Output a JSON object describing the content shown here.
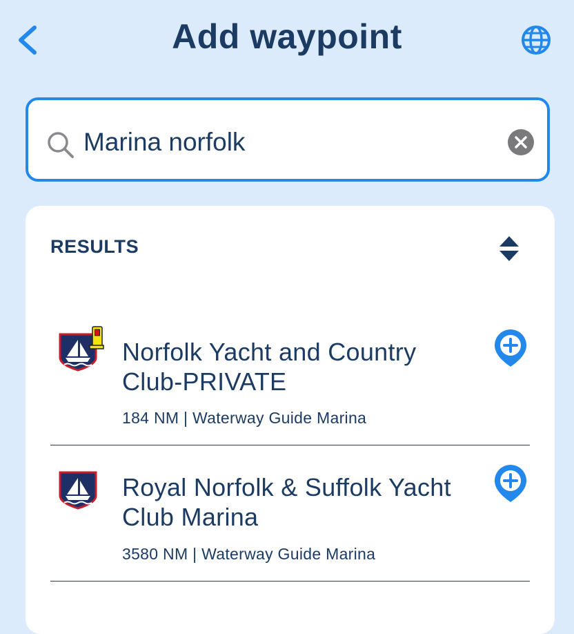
{
  "header": {
    "title": "Add waypoint"
  },
  "search": {
    "value": "Marina norfolk",
    "placeholder": ""
  },
  "results": {
    "heading": "RESULTS",
    "items": [
      {
        "title": "Norfolk Yacht and Country Club-PRIVATE",
        "meta": "184 NM | Waterway Guide Marina",
        "has_fuel_badge": true
      },
      {
        "title": "Royal Norfolk & Suffolk Yacht Club Marina",
        "meta": "3580 NM | Waterway Guide Marina",
        "has_fuel_badge": false
      }
    ]
  },
  "colors": {
    "accent": "#2388ec",
    "text": "#1c3b63",
    "background": "#dcebfb",
    "marina_navy": "#1e2f66",
    "marina_red": "#c41e2a"
  },
  "icons": [
    "back-arrow-icon",
    "globe-icon",
    "search-icon",
    "clear-icon",
    "sort-icon",
    "marina-icon",
    "fuel-icon",
    "add-waypoint-icon"
  ]
}
